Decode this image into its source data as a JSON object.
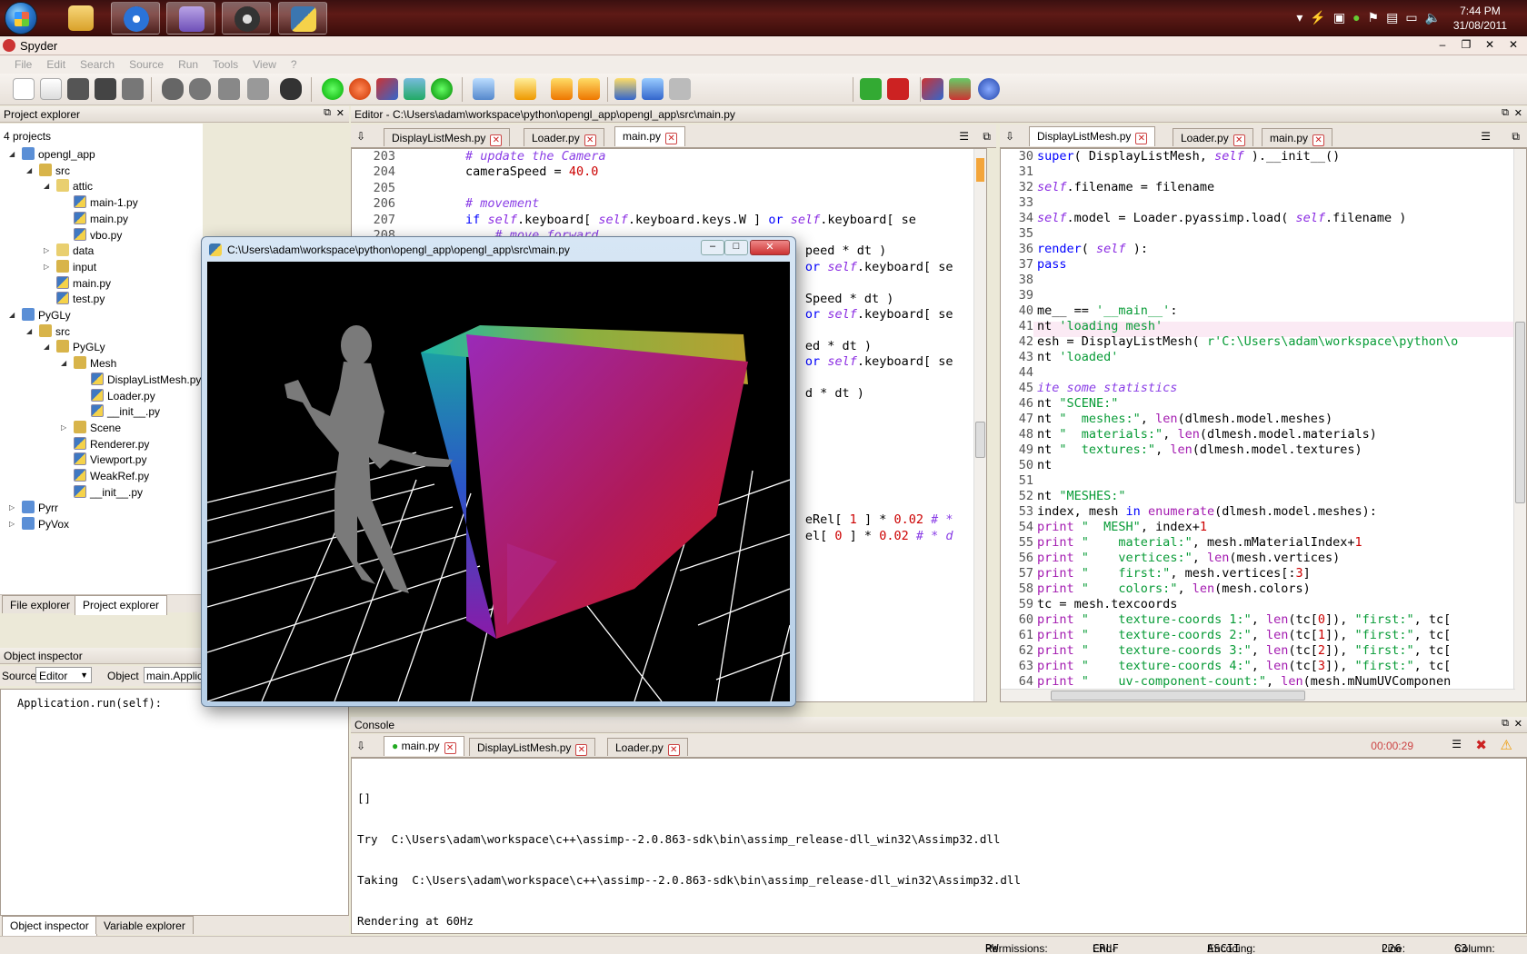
{
  "taskbar": {
    "clock_time": "7:44 PM",
    "clock_date": "31/08/2011",
    "tray_icons": [
      "chevron-up-icon",
      "lightning-icon",
      "network-share-icon",
      "security-icon",
      "flag-icon",
      "usb-icon",
      "display-icon",
      "speaker-icon"
    ]
  },
  "window": {
    "title": "Spyder",
    "minimize": "–",
    "maximize": "❐",
    "close": "✕"
  },
  "menu": [
    "File",
    "Edit",
    "Search",
    "Source",
    "Run",
    "Tools",
    "View",
    "?"
  ],
  "project_explorer": {
    "header": "Project explorer",
    "count": "4 projects",
    "tree": [
      {
        "label": "opengl_app",
        "depth": 0,
        "expanded": true,
        "kind": "project"
      },
      {
        "label": "src",
        "depth": 1,
        "expanded": true,
        "kind": "package"
      },
      {
        "label": "attic",
        "depth": 2,
        "expanded": true,
        "kind": "folder"
      },
      {
        "label": "main-1.py",
        "depth": 3,
        "kind": "py"
      },
      {
        "label": "main.py",
        "depth": 3,
        "kind": "py"
      },
      {
        "label": "vbo.py",
        "depth": 3,
        "kind": "py"
      },
      {
        "label": "data",
        "depth": 2,
        "expanded": false,
        "kind": "folder"
      },
      {
        "label": "input",
        "depth": 2,
        "expanded": false,
        "kind": "package"
      },
      {
        "label": "main.py",
        "depth": 2,
        "kind": "py"
      },
      {
        "label": "test.py",
        "depth": 2,
        "kind": "py"
      },
      {
        "label": "PyGLy",
        "depth": 0,
        "expanded": true,
        "kind": "project"
      },
      {
        "label": "src",
        "depth": 1,
        "expanded": true,
        "kind": "package"
      },
      {
        "label": "PyGLy",
        "depth": 2,
        "expanded": true,
        "kind": "package"
      },
      {
        "label": "Mesh",
        "depth": 3,
        "expanded": true,
        "kind": "package"
      },
      {
        "label": "DisplayListMesh.py",
        "depth": 4,
        "kind": "py"
      },
      {
        "label": "Loader.py",
        "depth": 4,
        "kind": "py"
      },
      {
        "label": "__init__.py",
        "depth": 4,
        "kind": "py"
      },
      {
        "label": "Scene",
        "depth": 3,
        "expanded": false,
        "kind": "package"
      },
      {
        "label": "Renderer.py",
        "depth": 3,
        "kind": "py"
      },
      {
        "label": "Viewport.py",
        "depth": 3,
        "kind": "py"
      },
      {
        "label": "WeakRef.py",
        "depth": 3,
        "kind": "py"
      },
      {
        "label": "__init__.py",
        "depth": 3,
        "kind": "py"
      },
      {
        "label": "Pyrr",
        "depth": 0,
        "expanded": false,
        "kind": "project"
      },
      {
        "label": "PyVox",
        "depth": 0,
        "expanded": false,
        "kind": "project"
      }
    ],
    "tabs": [
      "File explorer",
      "Project explorer"
    ]
  },
  "object_inspector": {
    "header": "Object inspector",
    "source_label": "Source",
    "source_value": "Editor",
    "object_label": "Object",
    "object_value": "main.Applica",
    "content": "Application.run(self):",
    "tabs": [
      "Object inspector",
      "Variable explorer"
    ]
  },
  "editor": {
    "header": "Editor - C:\\Users\\adam\\workspace\\python\\opengl_app\\opengl_app\\src\\main.py",
    "left_tabs": [
      "DisplayListMesh.py",
      "Loader.py",
      "main.py"
    ],
    "right_tabs": [
      "DisplayListMesh.py",
      "Loader.py",
      "main.py"
    ]
  },
  "gl_window": {
    "title": "C:\\Users\\adam\\workspace\\python\\opengl_app\\opengl_app\\src\\main.py"
  },
  "console": {
    "header": "Console",
    "tabs": [
      "main.py",
      "DisplayListMesh.py",
      "Loader.py"
    ],
    "timer": "00:00:29",
    "lines": [
      "[]",
      "Try  C:\\Users\\adam\\workspace\\c++\\assimp--2.0.863-sdk\\bin\\assimp_release-dll_win32\\Assimp32.dll",
      "Taking  C:\\Users\\adam\\workspace\\c++\\assimp--2.0.863-sdk\\bin\\assimp_release-dll_win32\\Assimp32.dll",
      "Rendering at 60Hz"
    ]
  },
  "status": {
    "permissions_label": "Permissions:",
    "permissions": "RW",
    "eol_label": "End-of-lines:",
    "eol": "CRLF",
    "encoding_label": "Encoding:",
    "encoding": "ASCII",
    "line_label": "Line:",
    "line": "226",
    "column_label": "Column:",
    "column": "63"
  },
  "colors": {
    "taskbar": "#4a1512",
    "keyword": "#0000ff",
    "self": "#8a2be2",
    "string": "#079b36",
    "number": "#cc0000"
  }
}
